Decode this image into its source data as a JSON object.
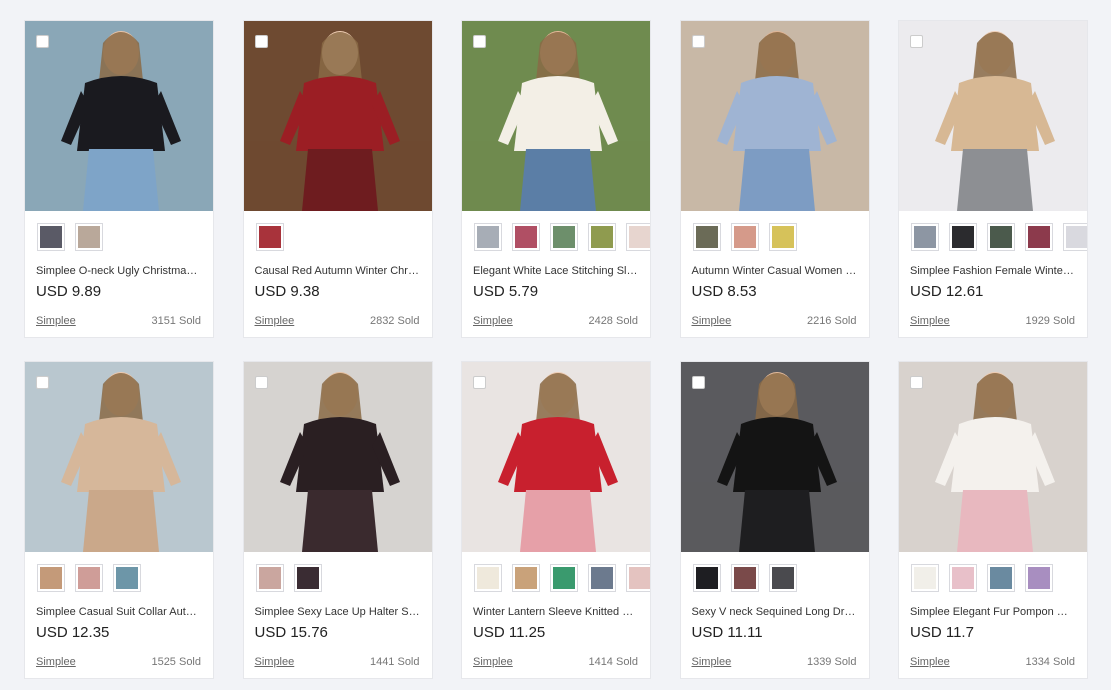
{
  "products": [
    {
      "title": "Simplee O-neck Ugly Christmas Sweater",
      "price": "USD 9.89",
      "store": "Simplee",
      "sold": "3151 Sold",
      "image_colors": {
        "bg": "#8aa7b7",
        "top": "#1a1a1f",
        "bottom": "#7ea4c8",
        "skin": "#e8c3a7"
      },
      "swatches": [
        "#5a5a66",
        "#b9a89a"
      ]
    },
    {
      "title": "Causal Red Autumn Winter Christmas Sweater",
      "price": "USD 9.38",
      "store": "Simplee",
      "sold": "2832 Sold",
      "image_colors": {
        "bg": "#6e4a31",
        "top": "#9b1e24",
        "bottom": "#6e1c1f",
        "skin": "#f0cfb5"
      },
      "swatches": [
        "#a8333b"
      ]
    },
    {
      "title": "Elegant White Lace Stitching Sleeveless Top",
      "price": "USD 5.79",
      "store": "Simplee",
      "sold": "2428 Sold",
      "image_colors": {
        "bg": "#6f8b4f",
        "top": "#f3efe6",
        "bottom": "#5b7ea6",
        "skin": "#e6b99a"
      },
      "swatches": [
        "#a7adb6",
        "#b04f64",
        "#6d8f6b",
        "#8f9b4f",
        "#e7d5cf"
      ]
    },
    {
      "title": "Autumn Winter Casual Women Plaid Shirt",
      "price": "USD 8.53",
      "store": "Simplee",
      "sold": "2216 Sold",
      "image_colors": {
        "bg": "#c8b8a6",
        "top": "#9fb4d3",
        "bottom": "#7d9cc3",
        "skin": "#e0b596"
      },
      "swatches": [
        "#6b6b57",
        "#d59a8a",
        "#d6c25a"
      ]
    },
    {
      "title": "Simplee Fashion Female Winter Coat",
      "price": "USD 12.61",
      "store": "Simplee",
      "sold": "1929 Sold",
      "image_colors": {
        "bg": "#ecebee",
        "top": "#d7b894",
        "bottom": "#8d8f93",
        "skin": "#edcdb5"
      },
      "swatches": [
        "#8d96a3",
        "#2b2b2e",
        "#4b5a4c",
        "#8c3a4c",
        "#d9d9df"
      ]
    },
    {
      "title": "Simplee Casual Suit Collar Autumn Dress",
      "price": "USD 12.35",
      "store": "Simplee",
      "sold": "1525 Sold",
      "image_colors": {
        "bg": "#b9c7cf",
        "top": "#d6b79a",
        "bottom": "#caa88a",
        "skin": "#ecc8ad"
      },
      "swatches": [
        "#c49a79",
        "#cf9d98",
        "#6d96a8"
      ]
    },
    {
      "title": "Simplee Sexy Lace Up Halter Sequin Dress",
      "price": "USD 15.76",
      "store": "Simplee",
      "sold": "1441 Sold",
      "image_colors": {
        "bg": "#d6d3d0",
        "top": "#2a1f22",
        "bottom": "#3a2a2e",
        "skin": "#e5bf9f"
      },
      "swatches": [
        "#caa69f",
        "#3a2c33"
      ]
    },
    {
      "title": "Winter Lantern Sleeve Knitted Sweater",
      "price": "USD 11.25",
      "store": "Simplee",
      "sold": "1414 Sold",
      "image_colors": {
        "bg": "#e9e4e2",
        "top": "#c8202e",
        "bottom": "#e6a0a8",
        "skin": "#efcdb5"
      },
      "swatches": [
        "#efe9dc",
        "#c9a27a",
        "#3a9a6e",
        "#6c7a8e",
        "#e4c3c0"
      ]
    },
    {
      "title": "Sexy V neck Sequined Long Dress",
      "price": "USD 11.11",
      "store": "Simplee",
      "sold": "1339 Sold",
      "image_colors": {
        "bg": "#5a5a5e",
        "top": "#141414",
        "bottom": "#1e1e20",
        "skin": "#e3bb9c"
      },
      "swatches": [
        "#1e1e22",
        "#7a4a4a",
        "#4a4a4e"
      ]
    },
    {
      "title": "Simplee Elegant Fur Pompon White Sweater",
      "price": "USD 11.7",
      "store": "Simplee",
      "sold": "1334 Sold",
      "image_colors": {
        "bg": "#d8d2cd",
        "top": "#f4f1ed",
        "bottom": "#e8b8bf",
        "skin": "#efcbb0"
      },
      "swatches": [
        "#f1efe9",
        "#e8c0c9",
        "#6a8aa0",
        "#a88ec0"
      ]
    }
  ]
}
